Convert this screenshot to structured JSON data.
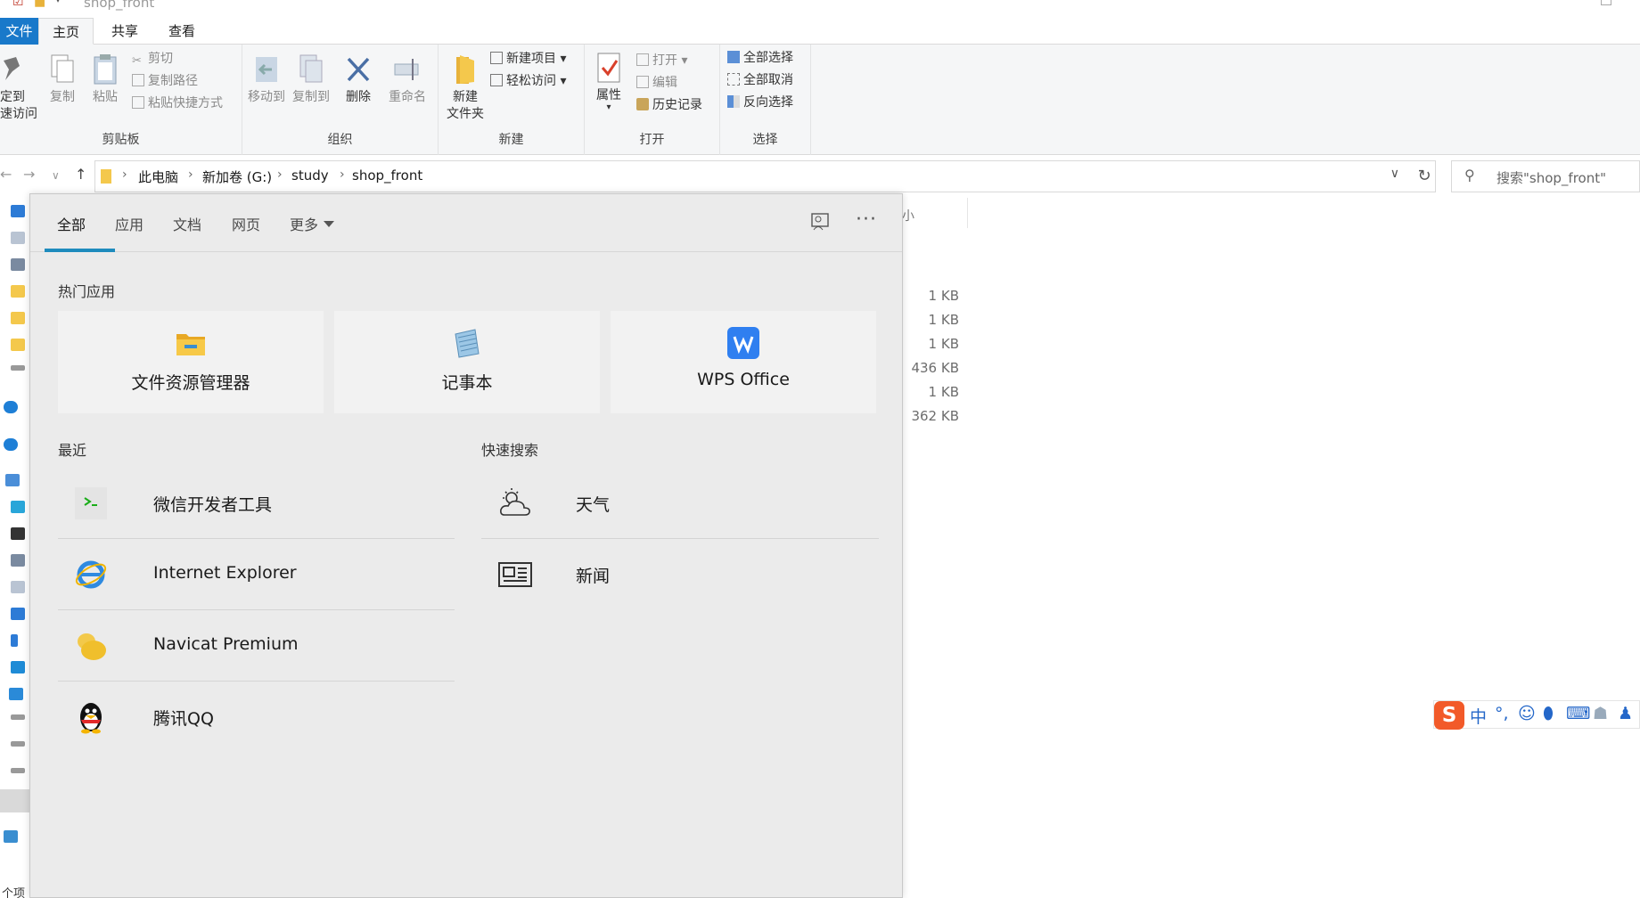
{
  "window": {
    "title": "shop_front"
  },
  "ribbon": {
    "tabs": [
      "文件",
      "主页",
      "共享",
      "查看"
    ],
    "clipboard": {
      "pin_line1": "定到",
      "pin_line2": "速访问",
      "copy": "复制",
      "paste": "粘贴",
      "cut": "剪切",
      "copy_path": "复制路径",
      "paste_shortcut": "粘贴快捷方式",
      "group": "剪贴板"
    },
    "organize": {
      "move_to": "移动到",
      "copy_to": "复制到",
      "delete": "删除",
      "rename": "重命名",
      "group": "组织"
    },
    "new": {
      "new_folder_line1": "新建",
      "new_folder_line2": "文件夹",
      "new_item": "新建项目",
      "easy_access": "轻松访问",
      "group": "新建"
    },
    "open": {
      "properties": "属性",
      "open": "打开",
      "edit": "编辑",
      "history": "历史记录",
      "group": "打开"
    },
    "select": {
      "select_all": "全部选择",
      "select_none": "全部取消",
      "invert": "反向选择",
      "group": "选择"
    }
  },
  "address": {
    "crumbs": [
      "此电脑",
      "新加卷 (G:)",
      "study",
      "shop_front"
    ],
    "search_placeholder": "搜索\"shop_front\""
  },
  "file_list": {
    "column_head_partial": "小",
    "sizes": [
      "1 KB",
      "1 KB",
      "1 KB",
      "436 KB",
      "1 KB",
      "362 KB"
    ]
  },
  "status_bar": {
    "partial": "个项"
  },
  "search_flyout": {
    "tabs": [
      {
        "label": "全部",
        "active": true
      },
      {
        "label": "应用",
        "active": false
      },
      {
        "label": "文档",
        "active": false
      },
      {
        "label": "网页",
        "active": false
      },
      {
        "label": "更多",
        "active": false
      }
    ],
    "top_apps_title": "热门应用",
    "top_apps": [
      {
        "name": "文件资源管理器",
        "icon": "file-explorer-icon"
      },
      {
        "name": "记事本",
        "icon": "notepad-icon"
      },
      {
        "name": "WPS Office",
        "icon": "wps-icon"
      }
    ],
    "recent_title": "最近",
    "recent": [
      {
        "name": "微信开发者工具",
        "icon": "wechat-devtools-icon"
      },
      {
        "name": "Internet Explorer",
        "icon": "internet-explorer-icon"
      },
      {
        "name": "Navicat Premium",
        "icon": "navicat-icon"
      },
      {
        "name": "腾讯QQ",
        "icon": "qq-penguin-icon"
      }
    ],
    "quick_search_title": "快速搜索",
    "quick_search": [
      {
        "name": "天气",
        "icon": "weather-icon"
      },
      {
        "name": "新闻",
        "icon": "news-icon"
      }
    ]
  },
  "ime": {
    "mode": "中",
    "punct": "°,"
  },
  "colors": {
    "accent": "#1e8bbd",
    "file_tab": "#1979ca",
    "flyout_bg": "#ebebeb",
    "sogou": "#f25a29"
  }
}
